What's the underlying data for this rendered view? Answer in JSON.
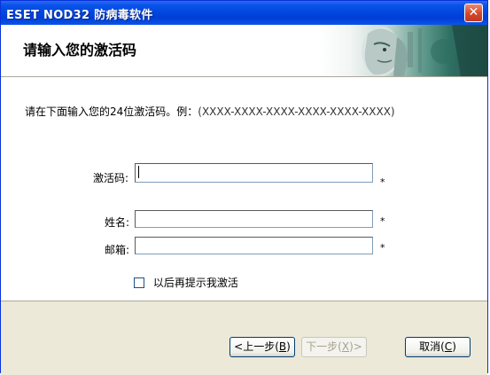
{
  "window": {
    "title": "ESET NOD32 防病毒软件"
  },
  "header": {
    "title": "请输入您的激活码"
  },
  "instruction": {
    "text": "请在下面输入您的24位激活码。例：",
    "example": "(XXXX-XXXX-XXXX-XXXX-XXXX-XXXX)"
  },
  "form": {
    "activation_label": "激活码:",
    "activation_value": "",
    "name_label": "姓名:",
    "name_value": "",
    "email_label": "邮箱:",
    "email_value": "",
    "required_mark": "*",
    "remind_label": "以后再提示我激活",
    "remind_checked": false
  },
  "buttons": {
    "back_label": "<上一步(",
    "back_hotkey": "B",
    "back_close": ")",
    "next_label": "下一步(",
    "next_hotkey": "X",
    "next_close": ")>",
    "cancel_label": "取消(",
    "cancel_hotkey": "C",
    "cancel_close": ")"
  },
  "colors": {
    "titlebar": "#0a53e9",
    "close": "#d4462c",
    "face": "#ece9d8"
  },
  "icons": {
    "close": "close-icon",
    "robot": "robot-face-image"
  }
}
